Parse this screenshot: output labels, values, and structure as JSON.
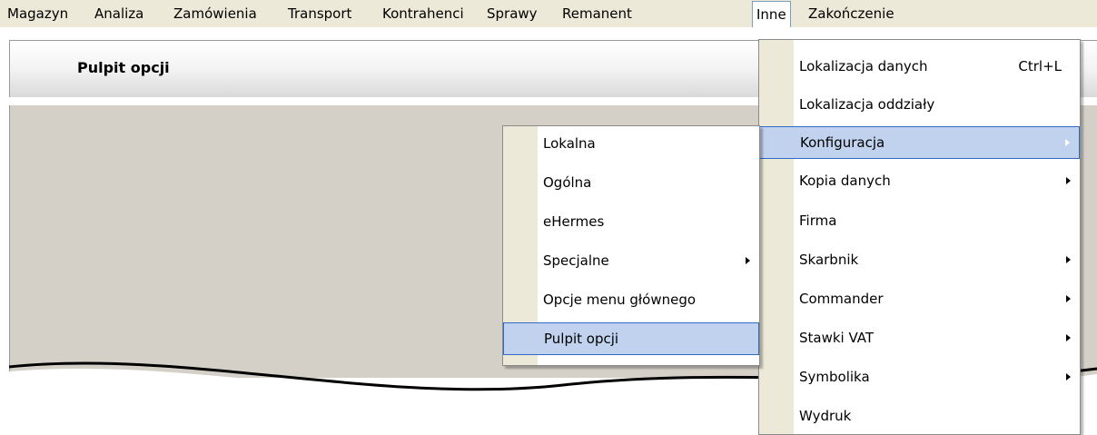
{
  "menubar": {
    "items": [
      {
        "label": "Magazyn"
      },
      {
        "label": "Analiza"
      },
      {
        "label": "Zamówienia"
      },
      {
        "label": "Transport"
      },
      {
        "label": "Kontrahenci"
      },
      {
        "label": "Sprawy"
      },
      {
        "label": "Remanent"
      },
      {
        "label": "Inne"
      },
      {
        "label": "Zakończenie"
      }
    ]
  },
  "panel": {
    "title": "Pulpit opcji"
  },
  "inne_menu": {
    "items": [
      {
        "label": "Lokalizacja danych",
        "shortcut": "Ctrl+L"
      },
      {
        "label": "Lokalizacja oddziały"
      },
      {
        "label": "Konfiguracja"
      },
      {
        "label": "Kopia danych"
      },
      {
        "label": "Firma"
      },
      {
        "label": "Skarbnik"
      },
      {
        "label": "Commander"
      },
      {
        "label": "Stawki VAT"
      },
      {
        "label": "Symbolika"
      },
      {
        "label": "Wydruk"
      }
    ]
  },
  "konfiguracja_menu": {
    "items": [
      {
        "label": "Lokalna"
      },
      {
        "label": "Ogólna"
      },
      {
        "label": "eHermes"
      },
      {
        "label": "Specjalne"
      },
      {
        "label": "Opcje menu głównego"
      },
      {
        "label": "Pulpit opcji"
      }
    ]
  },
  "colors": {
    "menubar_bg": "#ece9d8",
    "highlight_bg": "#c1d2ee",
    "highlight_border": "#316ac5",
    "panel_body": "#d4d0c8"
  }
}
